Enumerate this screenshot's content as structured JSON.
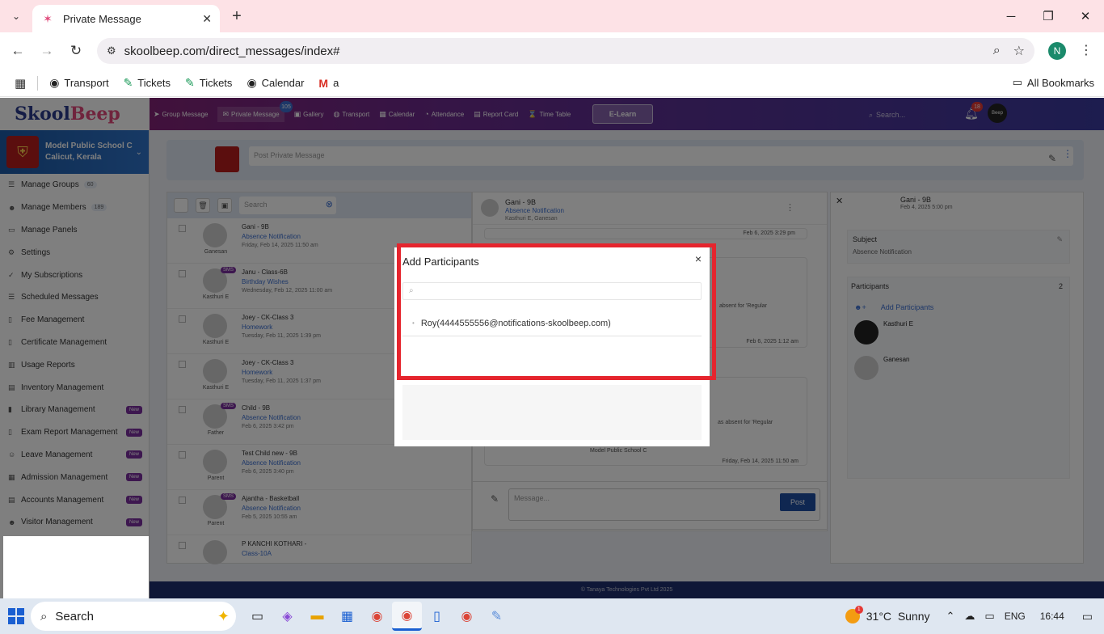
{
  "browser": {
    "tab_title": "Private Message",
    "url": "skoolbeep.com/direct_messages/index#",
    "profile_initial": "N",
    "bookmarks": [
      {
        "label": "Transport",
        "icon": "globe-icon"
      },
      {
        "label": "Tickets",
        "icon": "tickets-icon"
      },
      {
        "label": "Tickets",
        "icon": "tickets-icon"
      },
      {
        "label": "Calendar",
        "icon": "globe-icon"
      },
      {
        "label": "a",
        "icon": "gmail-icon"
      }
    ],
    "all_bookmarks": "All Bookmarks"
  },
  "app": {
    "logo": {
      "part1": "Skool",
      "part2": "Beep"
    },
    "nav": [
      {
        "label": "Group Message"
      },
      {
        "label": "Private Message"
      },
      {
        "label": "Gallery"
      },
      {
        "label": "Transport"
      },
      {
        "label": "Calendar"
      },
      {
        "label": "Attendance"
      },
      {
        "label": "Report Card"
      },
      {
        "label": "Time Table"
      }
    ],
    "nav_badge": "105",
    "elearn": "E-Learn",
    "search_placeholder": "Search...",
    "bell_count": "18",
    "user_avatar": "Beep",
    "school": {
      "name": "Model Public School C",
      "location": "Calicut, Kerala"
    },
    "sidebar": [
      {
        "label": "Manage Groups",
        "count": "60"
      },
      {
        "label": "Manage Members",
        "count": "189"
      },
      {
        "label": "Manage Panels"
      },
      {
        "label": "Settings"
      },
      {
        "label": "My Subscriptions"
      },
      {
        "label": "Scheduled Messages"
      },
      {
        "label": "Fee Management"
      },
      {
        "label": "Certificate Management"
      },
      {
        "label": "Usage Reports"
      },
      {
        "label": "Inventory Management"
      },
      {
        "label": "Library Management",
        "new": "New"
      },
      {
        "label": "Exam Report Management",
        "new": "New"
      },
      {
        "label": "Leave Management",
        "new": "New"
      },
      {
        "label": "Admission Management",
        "new": "New"
      },
      {
        "label": "Accounts Management",
        "new": "New"
      },
      {
        "label": "Visitor Management",
        "new": "New"
      }
    ],
    "composer_placeholder": "Post Private Message",
    "list_search_placeholder": "Search",
    "messages": [
      {
        "title": "Gani - 9B",
        "subject": "Absence Notification",
        "date": "Friday, Feb 14, 2025 11:50 am",
        "who": "Ganesan"
      },
      {
        "title": "Janu - Class-6B",
        "subject": "Birthday Wishes",
        "date": "Wednesday, Feb 12, 2025 11:00 am",
        "who": "Kasthuri E",
        "sms": "SMS"
      },
      {
        "title": "Joey - CK-Class 3",
        "subject": "Homework",
        "date": "Tuesday, Feb 11, 2025 1:39 pm",
        "who": "Kasthuri E"
      },
      {
        "title": "Joey - CK-Class 3",
        "subject": "Homework",
        "date": "Tuesday, Feb 11, 2025 1:37 pm",
        "who": "Kasthuri E"
      },
      {
        "title": "Child - 9B",
        "subject": "Absence Notification",
        "date": "Feb 6, 2025 3:42 pm",
        "who": "Father",
        "sms": "SMS"
      },
      {
        "title": "Test Child new - 9B",
        "subject": "Absence Notification",
        "date": "Feb 6, 2025 3:40 pm",
        "who": "Parent"
      },
      {
        "title": "Ajantha - Basketball",
        "subject": "Absence Notification",
        "date": "Feb 5, 2025 10:55 am",
        "who": "Parent",
        "sms": "SMS"
      },
      {
        "title": "P KANCHI KOTHARI -",
        "subject": "Class-10A",
        "date": "",
        "who": ""
      }
    ],
    "thread": {
      "title": "Gani - 9B",
      "subject": "Absence Notification",
      "participants": "Kasthuri E, Ganesan",
      "bubble1_date": "Feb 6, 2025 3:29 pm",
      "bubble2_text": "absent for 'Regular",
      "bubble2_date": "Feb 6, 2025 1:12 am",
      "bubble3_text": "as absent for 'Regular",
      "bubble3_sender": "Model Public School C",
      "bubble3_date": "Friday, Feb 14, 2025 11:50 am",
      "message_placeholder": "Message...",
      "post": "Post"
    },
    "detail": {
      "title": "Gani - 9B",
      "date": "Feb 4, 2025 5:00 pm",
      "subject_label": "Subject",
      "subject_value": "Absence Notification",
      "participants_label": "Participants",
      "participants_count": "2",
      "add_participants": "Add Participants",
      "people": [
        "Kasthuri E",
        "Ganesan"
      ]
    },
    "footer": "© Tanaya Technologies Pvt Ltd 2025"
  },
  "modal": {
    "title": "Add Participants",
    "close": "×",
    "search_placeholder": "",
    "items": [
      "Roy(4444555556@notifications-skoolbeep.com)"
    ]
  },
  "taskbar": {
    "search_label": "Search",
    "temperature": "31°C",
    "weather": "Sunny",
    "weather_badge": "1",
    "language": "ENG",
    "time": "16:44"
  }
}
